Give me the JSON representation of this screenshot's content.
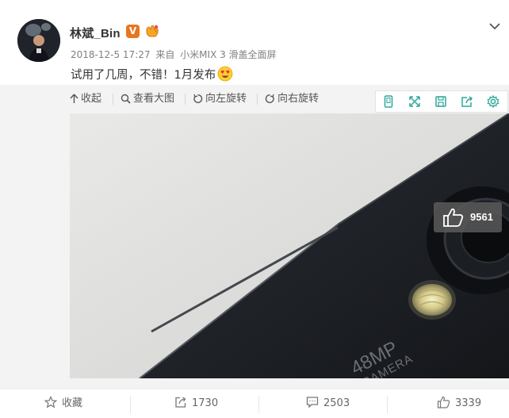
{
  "post": {
    "author": "林斌_Bin",
    "verified_mark": "V",
    "timestamp": "2018-12-5 17:27",
    "source_prefix": "来自",
    "source_device": "小米MIX 3 滑盖全面屏",
    "text": "试用了几周，不错！1月发布"
  },
  "image_toolbar": {
    "collapse": "收起",
    "view_large": "查看大图",
    "rotate_left": "向左旋转",
    "rotate_right": "向右旋转",
    "icons": [
      "phone-icon",
      "expand-icon",
      "save-icon",
      "share-icon",
      "settings-icon"
    ]
  },
  "photo": {
    "engraving_line1": "48MP",
    "engraving_line2": "CAMERA",
    "like_count": "9561"
  },
  "actions": {
    "favorite": "收藏",
    "repost_count": "1730",
    "comment_count": "2503",
    "like_count": "3339"
  },
  "colors": {
    "top_accent": "#b8e4e0",
    "verified_badge": "#e8761f",
    "toolbar_icon": "#2fa899"
  }
}
